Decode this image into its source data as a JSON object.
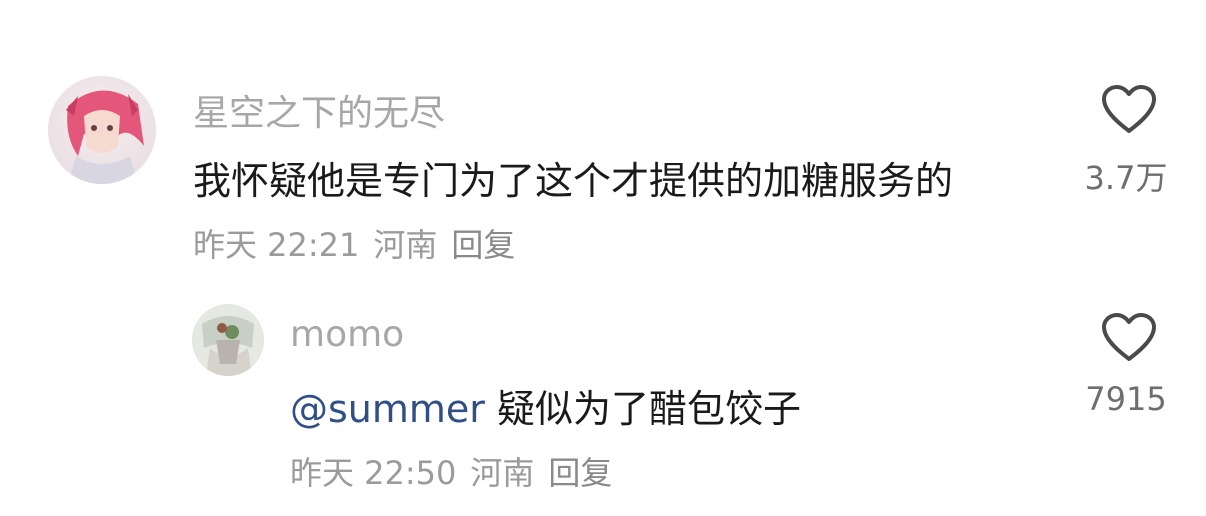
{
  "comments": [
    {
      "username": "星空之下的无尽",
      "text": "我怀疑他是专门为了这个才提供的加糖服务的",
      "time": "昨天 22:21",
      "location": "河南",
      "reply_label": "回复",
      "likes": "3.7万",
      "avatar_icon": "anime-avatar-icon"
    },
    {
      "username": "momo",
      "mention": "@summer",
      "text": " 疑似为了醋包饺子",
      "time": "昨天 22:50",
      "location": "河南",
      "reply_label": "回复",
      "likes": "7915",
      "avatar_icon": "illustration-avatar-icon"
    }
  ],
  "colors": {
    "username": "#a7a7a7",
    "content": "#1a1a1a",
    "mention": "#2f4f86",
    "meta": "#9b9b9b"
  }
}
